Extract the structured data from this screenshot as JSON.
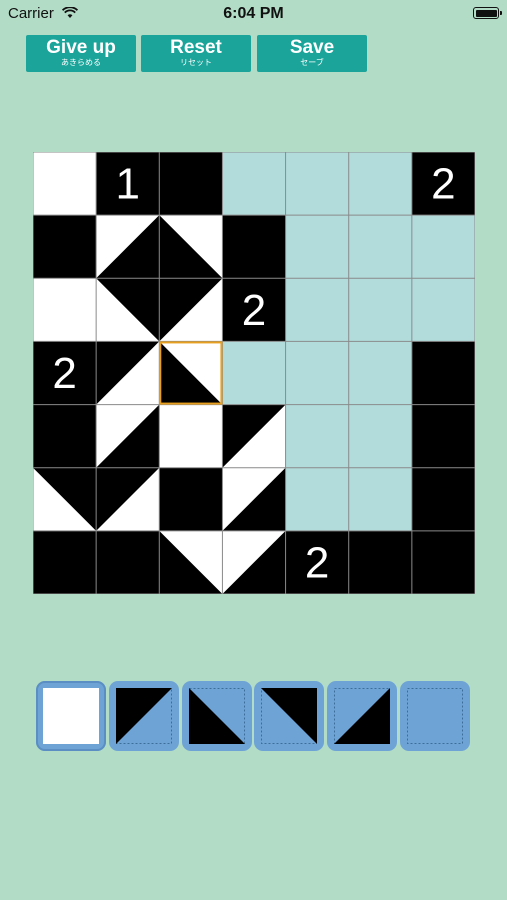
{
  "status_bar": {
    "carrier": "Carrier",
    "time": "6:04 PM"
  },
  "toolbar": {
    "give_up": {
      "label": "Give up",
      "sub_label": "あきらめる"
    },
    "reset": {
      "label": "Reset",
      "sub_label": "リセット"
    },
    "save": {
      "label": "Save",
      "sub_label": "セーブ"
    }
  },
  "colors": {
    "background": "#b2dcc5",
    "button": "#1aa49a",
    "shaded": "#b2dcdc",
    "black": "#000000",
    "selection": "#e8a020",
    "palette": "#6ea3d6"
  },
  "board": {
    "rows": 7,
    "cols": 7,
    "selected_cell": [
      3,
      2
    ],
    "cells": [
      [
        "white",
        "1",
        "black",
        "shaded",
        "shaded",
        "shaded",
        "2"
      ],
      [
        "black",
        "tri-br",
        "tri-bl",
        "black",
        "shaded",
        "shaded",
        "shaded"
      ],
      [
        "white",
        "tri-tr",
        "tri-tl",
        "2",
        "shaded",
        "shaded",
        "shaded"
      ],
      [
        "2",
        "tri-tl",
        "tri-bl",
        "shaded",
        "shaded",
        "shaded",
        "black"
      ],
      [
        "black",
        "tri-br",
        "white",
        "tri-tl",
        "shaded",
        "shaded",
        "black"
      ],
      [
        "tri-tr",
        "tri-tl",
        "black",
        "tri-br",
        "shaded",
        "shaded",
        "black"
      ],
      [
        "black",
        "black",
        "tri-bl",
        "tri-br",
        "2",
        "black",
        "black"
      ]
    ]
  },
  "palette": {
    "tiles": [
      "white",
      "tri-tl",
      "tri-bl",
      "tri-tr",
      "tri-br",
      "empty"
    ],
    "selected": 0
  }
}
